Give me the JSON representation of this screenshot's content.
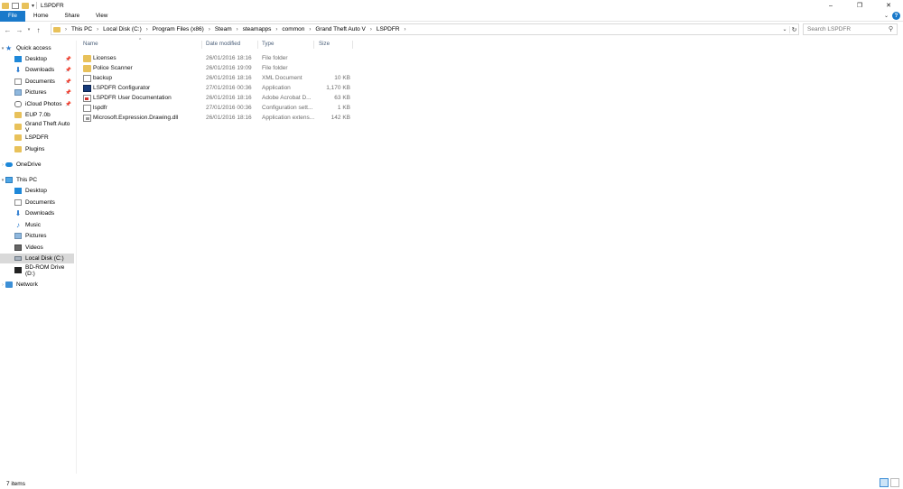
{
  "window": {
    "title": "LSPDFR",
    "controls": [
      "minimize-icon",
      "restore-icon",
      "close-icon"
    ]
  },
  "ribbon": {
    "tabs": [
      "File",
      "Home",
      "Share",
      "View"
    ]
  },
  "address": {
    "path": [
      "This PC",
      "Local Disk (C:)",
      "Program Files (x86)",
      "Steam",
      "steamapps",
      "common",
      "Grand Theft Auto V",
      "LSPDFR"
    ]
  },
  "search": {
    "placeholder": "Search LSPDFR"
  },
  "sidebar": {
    "quick_access": "Quick access",
    "quick_items": [
      {
        "label": "Desktop",
        "icon": "desktop-icon",
        "pinned": true
      },
      {
        "label": "Downloads",
        "icon": "downloads-icon",
        "pinned": true
      },
      {
        "label": "Documents",
        "icon": "documents-icon",
        "pinned": true
      },
      {
        "label": "Pictures",
        "icon": "pictures-icon",
        "pinned": true
      },
      {
        "label": "iCloud Photos",
        "icon": "icloud-icon",
        "pinned": true
      },
      {
        "label": "EUP 7.0b",
        "icon": "folder-icon",
        "pinned": false
      },
      {
        "label": "Grand Theft Auto V",
        "icon": "folder-icon",
        "pinned": false
      },
      {
        "label": "LSPDFR",
        "icon": "folder-icon",
        "pinned": false
      },
      {
        "label": "Plugins",
        "icon": "folder-icon",
        "pinned": false
      }
    ],
    "onedrive": "OneDrive",
    "this_pc": "This PC",
    "pc_items": [
      {
        "label": "Desktop",
        "icon": "desktop-icon"
      },
      {
        "label": "Documents",
        "icon": "documents-icon"
      },
      {
        "label": "Downloads",
        "icon": "downloads-icon"
      },
      {
        "label": "Music",
        "icon": "music-icon"
      },
      {
        "label": "Pictures",
        "icon": "pictures-icon"
      },
      {
        "label": "Videos",
        "icon": "videos-icon"
      },
      {
        "label": "Local Disk (C:)",
        "icon": "disk-icon",
        "selected": true
      },
      {
        "label": "BD-ROM Drive (D:)",
        "icon": "bd-rom-icon"
      }
    ],
    "network": "Network"
  },
  "columns": {
    "name": "Name",
    "date": "Date modified",
    "type": "Type",
    "size": "Size"
  },
  "files": [
    {
      "name": "Licenses",
      "date": "26/01/2016 18:16",
      "type": "File folder",
      "size": "",
      "icon": "folder-icon"
    },
    {
      "name": "Police Scanner",
      "date": "26/01/2016 19:09",
      "type": "File folder",
      "size": "",
      "icon": "folder-icon"
    },
    {
      "name": "backup",
      "date": "26/01/2016 18:16",
      "type": "XML Document",
      "size": "10 KB",
      "icon": "xml-file-icon"
    },
    {
      "name": "LSPDFR Configurator",
      "date": "27/01/2016 00:36",
      "type": "Application",
      "size": "1,170 KB",
      "icon": "app-icon"
    },
    {
      "name": "LSPDFR User Documentation",
      "date": "26/01/2016 18:16",
      "type": "Adobe Acrobat D...",
      "size": "63 KB",
      "icon": "pdf-icon"
    },
    {
      "name": "lspdfr",
      "date": "27/01/2016 00:36",
      "type": "Configuration sett...",
      "size": "1 KB",
      "icon": "config-file-icon"
    },
    {
      "name": "Microsoft.Expression.Drawing.dll",
      "date": "26/01/2016 18:16",
      "type": "Application extens...",
      "size": "142 KB",
      "icon": "dll-icon"
    }
  ],
  "status": {
    "item_count": "7 items"
  }
}
